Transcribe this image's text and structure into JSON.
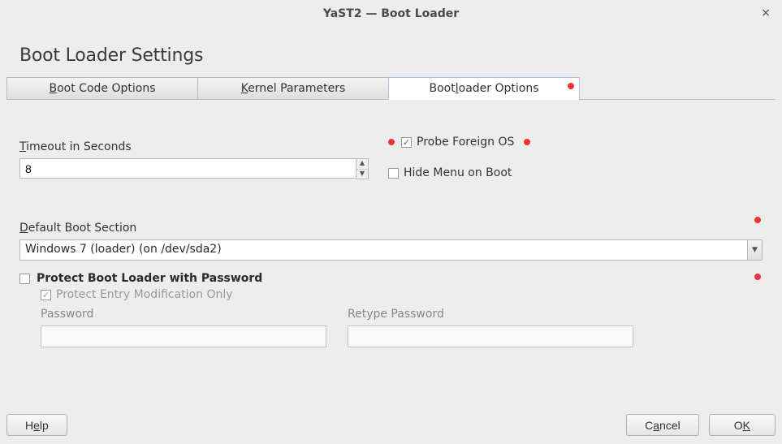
{
  "window": {
    "title": "YaST2 — Boot Loader"
  },
  "page": {
    "heading": "Boot Loader Settings"
  },
  "tabs": {
    "boot_code": "oot Code Options",
    "boot_code_key": "B",
    "kernel": "ernel Parameters",
    "kernel_key": "K",
    "options": "oader Options",
    "options_prefix": "Bootl",
    "options_key": "",
    "options_full": "Bootloader Options"
  },
  "timeout": {
    "label_pre": "T",
    "label_post": "imeout in Seconds",
    "value": "8"
  },
  "checks": {
    "probe_pre": "Probe ",
    "probe_key": "F",
    "probe_post": "oreign OS",
    "hide_pre": "H",
    "hide_key": "i",
    "hide_post": "de Menu on Boot"
  },
  "default_section": {
    "label_pre": "D",
    "label_post": "efault Boot Section",
    "value": "Windows 7 (loader) (on /dev/sda2)"
  },
  "protect": {
    "main": "Protect Boot Loader with Password",
    "sub_pre": "P",
    "sub_key": "r",
    "sub_post": "otect Entry Modification Only",
    "pw_label_pre": "P",
    "pw_label_post": "assword",
    "retype_label": "Retype Password"
  },
  "footer": {
    "help_pre": "H",
    "help_key": "e",
    "help_post": "lp",
    "cancel_pre": "C",
    "cancel_key": "a",
    "cancel_post": "ncel",
    "ok_pre": "O",
    "ok_key": "K",
    "ok_post": ""
  }
}
